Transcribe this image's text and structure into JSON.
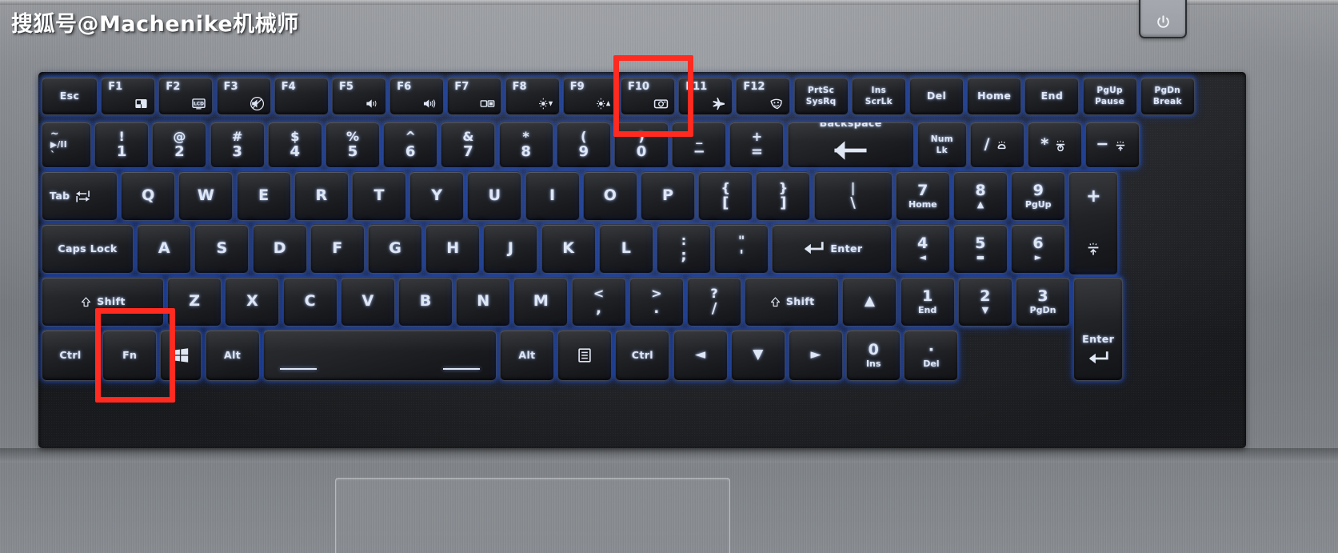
{
  "watermark": "搜狐号@Machenike机械师",
  "power_button": {
    "name": "power-button",
    "icon": "power-icon"
  },
  "highlights": [
    {
      "name": "f10-highlight",
      "target": "F10",
      "color": "#ff2a20"
    },
    {
      "name": "fn-highlight",
      "target": "Fn",
      "color": "#ff2a20"
    }
  ],
  "colors": {
    "highlight": "#ff2a20",
    "key_face": "#202226",
    "key_glow": "#2e5fe6",
    "legend": "#dfe6f4",
    "chassis": "#9ba0a6"
  },
  "rows": [
    {
      "name": "function-row",
      "keys": [
        {
          "name": "key-escape",
          "top": "Esc",
          "style": "small"
        },
        {
          "name": "key-f1",
          "top": "F1",
          "icon": "touchpad-icon",
          "style": "fn"
        },
        {
          "name": "key-f2",
          "top": "F2",
          "icon": "lcd-icon",
          "style": "fn"
        },
        {
          "name": "key-f3",
          "top": "F3",
          "icon": "mute-icon",
          "style": "fn"
        },
        {
          "name": "key-f4",
          "top": "F4",
          "style": "fn"
        },
        {
          "name": "key-f5",
          "top": "F5",
          "icon": "volume-down-icon",
          "style": "fn"
        },
        {
          "name": "key-f6",
          "top": "F6",
          "icon": "volume-up-icon",
          "style": "fn"
        },
        {
          "name": "key-f7",
          "top": "F7",
          "icon": "display-switch-icon",
          "style": "fn"
        },
        {
          "name": "key-f8",
          "top": "F8",
          "icon": "brightness-down-icon",
          "style": "fn"
        },
        {
          "name": "key-f9",
          "top": "F9",
          "icon": "brightness-up-icon",
          "style": "fn"
        },
        {
          "name": "key-f10",
          "top": "F10",
          "icon": "camera-icon",
          "style": "fn",
          "highlighted": true
        },
        {
          "name": "key-f11",
          "top": "F11",
          "icon": "airplane-icon",
          "style": "fn"
        },
        {
          "name": "key-f12",
          "top": "F12",
          "icon": "mask-icon",
          "style": "fn"
        },
        {
          "name": "key-print-screen",
          "top": "PrtSc",
          "bottom": "SysRq",
          "style": "stack"
        },
        {
          "name": "key-insert",
          "top": "Ins",
          "bottom": "ScrLk",
          "style": "stack"
        },
        {
          "name": "key-delete",
          "top": "Del",
          "style": "small"
        },
        {
          "name": "key-home",
          "top": "Home",
          "style": "small"
        },
        {
          "name": "key-end",
          "top": "End",
          "style": "small"
        },
        {
          "name": "key-page-up",
          "top": "PgUp",
          "bottom": "Pause",
          "style": "stack"
        },
        {
          "name": "key-page-down",
          "top": "PgDn",
          "bottom": "Break",
          "style": "stack"
        }
      ]
    },
    {
      "name": "number-row",
      "keys": [
        {
          "name": "key-tilde",
          "top": "~",
          "mid": "▶/II",
          "bottom": "`",
          "style": "triple"
        },
        {
          "name": "key-1",
          "top": "!",
          "bottom": "1",
          "style": "num"
        },
        {
          "name": "key-2",
          "top": "@",
          "bottom": "2",
          "style": "num"
        },
        {
          "name": "key-3",
          "top": "#",
          "bottom": "3",
          "style": "num"
        },
        {
          "name": "key-4",
          "top": "$",
          "bottom": "4",
          "style": "num"
        },
        {
          "name": "key-5",
          "top": "%",
          "bottom": "5",
          "style": "num"
        },
        {
          "name": "key-6",
          "top": "^",
          "bottom": "6",
          "style": "num"
        },
        {
          "name": "key-7",
          "top": "&",
          "bottom": "7",
          "style": "num"
        },
        {
          "name": "key-8",
          "top": "*",
          "bottom": "8",
          "style": "num"
        },
        {
          "name": "key-9",
          "top": "(",
          "bottom": "9",
          "style": "num"
        },
        {
          "name": "key-0",
          "top": ")",
          "bottom": "0",
          "style": "num"
        },
        {
          "name": "key-minus",
          "top": "_",
          "bottom": "−",
          "style": "num"
        },
        {
          "name": "key-equals",
          "top": "+",
          "bottom": "=",
          "style": "num"
        },
        {
          "name": "key-backspace",
          "top": "Backspace",
          "icon": "backspace-arrow-icon",
          "style": "wide"
        },
        {
          "name": "key-num-lock",
          "top": "Num",
          "bottom": "Lk",
          "style": "stack"
        },
        {
          "name": "key-numpad-divide",
          "top": "/",
          "icon": "backlight-down-icon",
          "style": "npfn"
        },
        {
          "name": "key-numpad-multiply",
          "top": "*",
          "icon": "backlight-toggle-icon",
          "style": "npfn"
        },
        {
          "name": "key-numpad-minus",
          "top": "−",
          "icon": "backlight-up-icon",
          "style": "npfn"
        }
      ]
    },
    {
      "name": "qwerty-row",
      "keys": [
        {
          "name": "key-tab",
          "top": "Tab",
          "icon": "tab-icon",
          "style": "tab"
        },
        {
          "name": "key-q",
          "top": "Q",
          "style": "letter"
        },
        {
          "name": "key-w",
          "top": "W",
          "style": "letter"
        },
        {
          "name": "key-e",
          "top": "E",
          "style": "letter"
        },
        {
          "name": "key-r",
          "top": "R",
          "style": "letter"
        },
        {
          "name": "key-t",
          "top": "T",
          "style": "letter"
        },
        {
          "name": "key-y",
          "top": "Y",
          "style": "letter"
        },
        {
          "name": "key-u",
          "top": "U",
          "style": "letter"
        },
        {
          "name": "key-i",
          "top": "I",
          "style": "letter"
        },
        {
          "name": "key-o",
          "top": "O",
          "style": "letter"
        },
        {
          "name": "key-p",
          "top": "P",
          "style": "letter"
        },
        {
          "name": "key-bracket-left",
          "top": "{",
          "bottom": "[",
          "style": "num"
        },
        {
          "name": "key-bracket-right",
          "top": "}",
          "bottom": "]",
          "style": "num"
        },
        {
          "name": "key-backslash",
          "top": "|",
          "bottom": "\\",
          "style": "num"
        },
        {
          "name": "key-numpad-7",
          "top": "7",
          "bottom": "Home",
          "style": "np"
        },
        {
          "name": "key-numpad-8",
          "top": "8",
          "bottom": "▲",
          "style": "np"
        },
        {
          "name": "key-numpad-9",
          "top": "9",
          "bottom": "PgUp",
          "style": "np"
        },
        {
          "name": "key-numpad-plus",
          "top": "+",
          "icon": "backlight-bar-icon",
          "style": "tall"
        }
      ]
    },
    {
      "name": "home-row",
      "keys": [
        {
          "name": "key-caps-lock",
          "top": "Caps Lock",
          "style": "small"
        },
        {
          "name": "key-a",
          "top": "A",
          "style": "letter"
        },
        {
          "name": "key-s",
          "top": "S",
          "style": "letter"
        },
        {
          "name": "key-d",
          "top": "D",
          "style": "letter"
        },
        {
          "name": "key-f",
          "top": "F",
          "style": "letter"
        },
        {
          "name": "key-g",
          "top": "G",
          "style": "letter"
        },
        {
          "name": "key-h",
          "top": "H",
          "style": "letter"
        },
        {
          "name": "key-j",
          "top": "J",
          "style": "letter"
        },
        {
          "name": "key-k",
          "top": "K",
          "style": "letter"
        },
        {
          "name": "key-l",
          "top": "L",
          "style": "letter"
        },
        {
          "name": "key-semicolon",
          "top": ":",
          "bottom": ";",
          "style": "num"
        },
        {
          "name": "key-quote",
          "top": "\"",
          "bottom": "'",
          "style": "num"
        },
        {
          "name": "key-enter",
          "top": "Enter",
          "icon": "enter-arrow-icon",
          "style": "wide"
        },
        {
          "name": "key-numpad-4",
          "top": "4",
          "bottom": "◄",
          "style": "np"
        },
        {
          "name": "key-numpad-5",
          "top": "5",
          "bottom": "▬",
          "style": "np"
        },
        {
          "name": "key-numpad-6",
          "top": "6",
          "bottom": "►",
          "style": "np"
        }
      ]
    },
    {
      "name": "shift-row",
      "keys": [
        {
          "name": "key-shift-left",
          "top": "Shift",
          "icon": "shift-arrow-icon",
          "style": "mod"
        },
        {
          "name": "key-z",
          "top": "Z",
          "style": "letter"
        },
        {
          "name": "key-x",
          "top": "X",
          "style": "letter"
        },
        {
          "name": "key-c",
          "top": "C",
          "style": "letter"
        },
        {
          "name": "key-v",
          "top": "V",
          "style": "letter"
        },
        {
          "name": "key-b",
          "top": "B",
          "style": "letter"
        },
        {
          "name": "key-n",
          "top": "N",
          "style": "letter"
        },
        {
          "name": "key-m",
          "top": "M",
          "style": "letter"
        },
        {
          "name": "key-comma",
          "top": "<",
          "bottom": ",",
          "style": "num"
        },
        {
          "name": "key-period",
          "top": ">",
          "bottom": ".",
          "style": "num"
        },
        {
          "name": "key-slash",
          "top": "?",
          "bottom": "/",
          "style": "num"
        },
        {
          "name": "key-shift-right",
          "top": "Shift",
          "icon": "shift-arrow-icon",
          "style": "mod"
        },
        {
          "name": "key-arrow-up",
          "top": "▲",
          "style": "arrow"
        },
        {
          "name": "key-numpad-1",
          "top": "1",
          "bottom": "End",
          "style": "np"
        },
        {
          "name": "key-numpad-2",
          "top": "2",
          "bottom": "▼",
          "style": "np"
        },
        {
          "name": "key-numpad-3",
          "top": "3",
          "bottom": "PgDn",
          "style": "np"
        },
        {
          "name": "key-numpad-enter",
          "top": "Enter",
          "icon": "enter-arrow-icon",
          "style": "tall"
        }
      ]
    },
    {
      "name": "bottom-row",
      "keys": [
        {
          "name": "key-ctrl-left",
          "top": "Ctrl",
          "style": "small"
        },
        {
          "name": "key-fn",
          "top": "Fn",
          "style": "small",
          "highlighted": true
        },
        {
          "name": "key-windows",
          "icon": "windows-icon",
          "style": "iconkey"
        },
        {
          "name": "key-alt-left",
          "top": "Alt",
          "style": "small"
        },
        {
          "name": "key-space",
          "top": "",
          "style": "space"
        },
        {
          "name": "key-alt-right",
          "top": "Alt",
          "style": "small"
        },
        {
          "name": "key-menu",
          "icon": "menu-icon",
          "style": "iconkey"
        },
        {
          "name": "key-ctrl-right",
          "top": "Ctrl",
          "style": "small"
        },
        {
          "name": "key-arrow-left",
          "top": "◄",
          "style": "arrow"
        },
        {
          "name": "key-arrow-down",
          "top": "▼",
          "style": "arrow"
        },
        {
          "name": "key-arrow-right",
          "top": "►",
          "style": "arrow"
        },
        {
          "name": "key-numpad-0",
          "top": "0",
          "bottom": "Ins",
          "style": "np"
        },
        {
          "name": "key-numpad-period",
          "top": "·",
          "bottom": "Del",
          "style": "np"
        }
      ]
    }
  ]
}
